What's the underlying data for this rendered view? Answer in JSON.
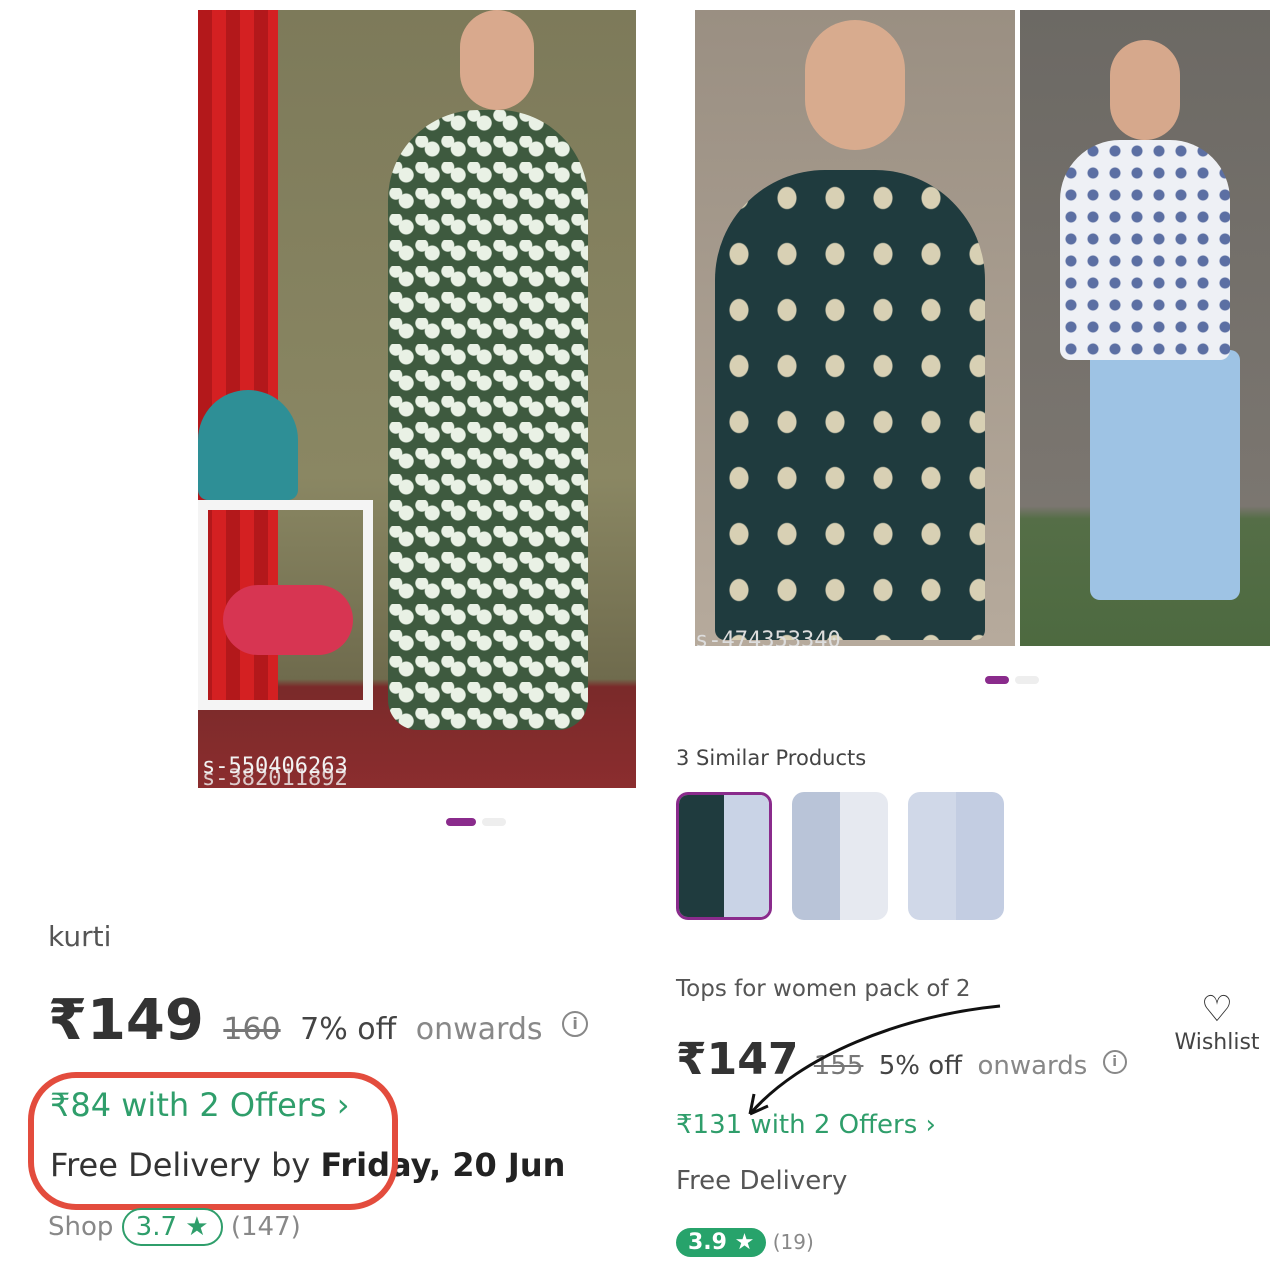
{
  "left_product": {
    "sku_text": "s-550406263",
    "sku_overlay": "s-382011892",
    "name": "kurti",
    "price": "₹149",
    "mrp": "160",
    "discount": "7% off",
    "onwards": "onwards",
    "offer_text": "₹84 with 2 Offers",
    "delivery_prefix": "Free Delivery by",
    "delivery_date": "Friday, 20 Jun",
    "shop_label": "Shop",
    "rating": "3.7 ★",
    "rating_count": "(147)",
    "image_index": 1,
    "image_count": 2
  },
  "right_product": {
    "sku_text": "s-474353340",
    "similar_title": "3 Similar Products",
    "title": "Tops for women pack of 2",
    "price": "₹147",
    "mrp": "155",
    "discount": "5% off",
    "onwards": "onwards",
    "offer_text": "₹131 with 2 Offers",
    "delivery": "Free Delivery",
    "rating": "3.9 ★",
    "rating_count": "(19)",
    "wishlist_label": "Wishlist",
    "image_index": 1,
    "image_count": 2
  },
  "icons": {
    "info": "i",
    "chevron": "›",
    "heart": "♡"
  },
  "colors": {
    "accent_purple": "#8a2b8c",
    "offer_green": "#2f9e6b",
    "highlight_red": "#e34c3d"
  }
}
